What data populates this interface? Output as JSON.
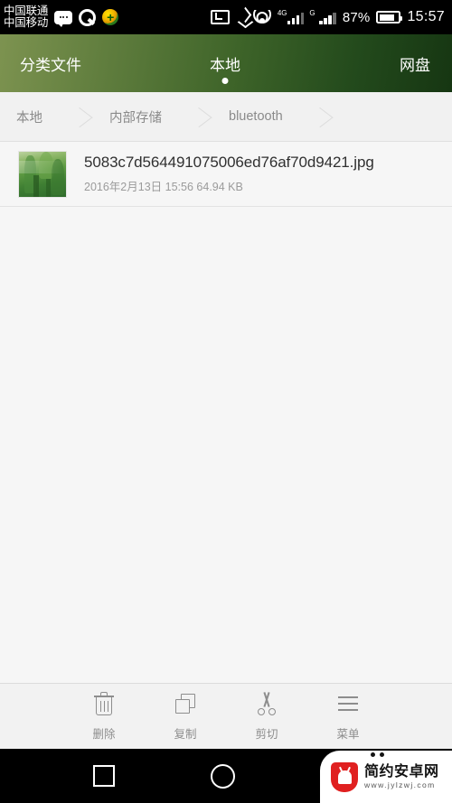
{
  "status_bar": {
    "carrier_line1": "中国联通",
    "carrier_line2": "中国移动",
    "icons": [
      "message-icon",
      "qq-icon",
      "browser-globe-icon",
      "cast-icon",
      "bluetooth-icon",
      "wifi-icon"
    ],
    "signal_1_label": "4G",
    "signal_2_label": "G",
    "battery_percent": "87%",
    "battery_level": 80,
    "time": "15:57"
  },
  "tabs": [
    {
      "label": "分类文件",
      "active": false
    },
    {
      "label": "本地",
      "active": true
    },
    {
      "label": "网盘",
      "active": false
    }
  ],
  "breadcrumb": {
    "items": [
      "本地",
      "内部存储",
      "bluetooth"
    ]
  },
  "file_list": [
    {
      "name": "5083c7d564491075006ed76af70d9421.jpg",
      "date": "2016年2月13日",
      "time": "15:56",
      "size": "64.94 KB",
      "thumbnail": "forest-image-thumbnail"
    }
  ],
  "toolbar": [
    {
      "label": "删除",
      "icon": "trash-icon"
    },
    {
      "label": "复制",
      "icon": "copy-icon"
    },
    {
      "label": "剪切",
      "icon": "scissors-icon"
    },
    {
      "label": "菜单",
      "icon": "menu-icon"
    }
  ],
  "nav_bar": {
    "recents": "recents-square-icon",
    "home": "home-circle-icon"
  },
  "watermark": {
    "site_name": "简约安卓网",
    "url": "www.jylzwj.com"
  },
  "colors": {
    "tab_gradient_start": "#7d9350",
    "tab_gradient_end": "#163612",
    "page_background": "#f6f6f6",
    "breadcrumb_background": "#f1f1f1",
    "toolbar_background": "#f2f2f2",
    "filename_text": "#303030",
    "meta_text": "#9b9b9b",
    "watermark_red": "#e02020"
  }
}
